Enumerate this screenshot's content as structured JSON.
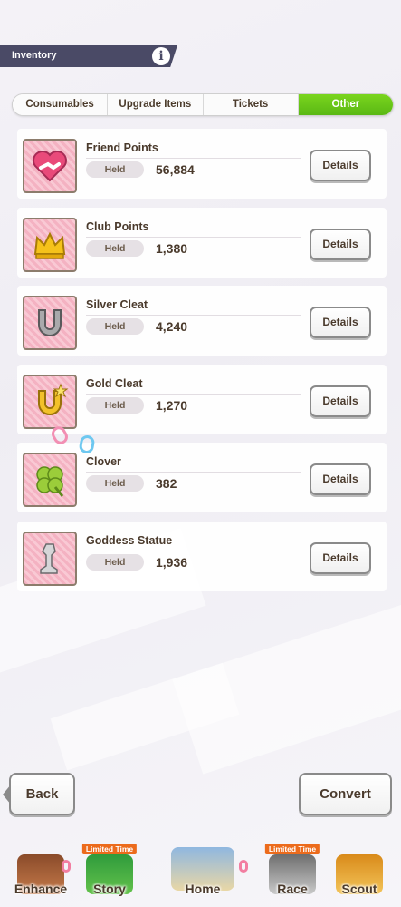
{
  "header": {
    "title": "Inventory",
    "info_icon": "info-icon"
  },
  "tabs": [
    {
      "label": "Consumables",
      "active": false
    },
    {
      "label": "Upgrade Items",
      "active": false
    },
    {
      "label": "Tickets",
      "active": false
    },
    {
      "label": "Other",
      "active": true
    }
  ],
  "held_label": "Held",
  "details_label": "Details",
  "items": [
    {
      "name": "Friend Points",
      "held": "56,884",
      "icon": "friend-points-icon"
    },
    {
      "name": "Club Points",
      "held": "1,380",
      "icon": "club-points-crown-icon"
    },
    {
      "name": "Silver Cleat",
      "held": "4,240",
      "icon": "silver-cleat-icon"
    },
    {
      "name": "Gold Cleat",
      "held": "1,270",
      "icon": "gold-cleat-icon"
    },
    {
      "name": "Clover",
      "held": "382",
      "icon": "clover-icon"
    },
    {
      "name": "Goddess Statue",
      "held": "1,936",
      "icon": "goddess-statue-icon"
    }
  ],
  "footer": {
    "back_label": "Back",
    "convert_label": "Convert"
  },
  "nav": [
    {
      "label": "Enhance",
      "badge": ""
    },
    {
      "label": "Story",
      "badge": "Limited Time"
    },
    {
      "label": "Home",
      "badge": ""
    },
    {
      "label": "Race",
      "badge": "Limited Time"
    },
    {
      "label": "Scout",
      "badge": ""
    }
  ],
  "colors": {
    "tab_active": "#6cc81a",
    "header_bg": "#4a4a66",
    "icon_bg": "#f7bfcc"
  }
}
